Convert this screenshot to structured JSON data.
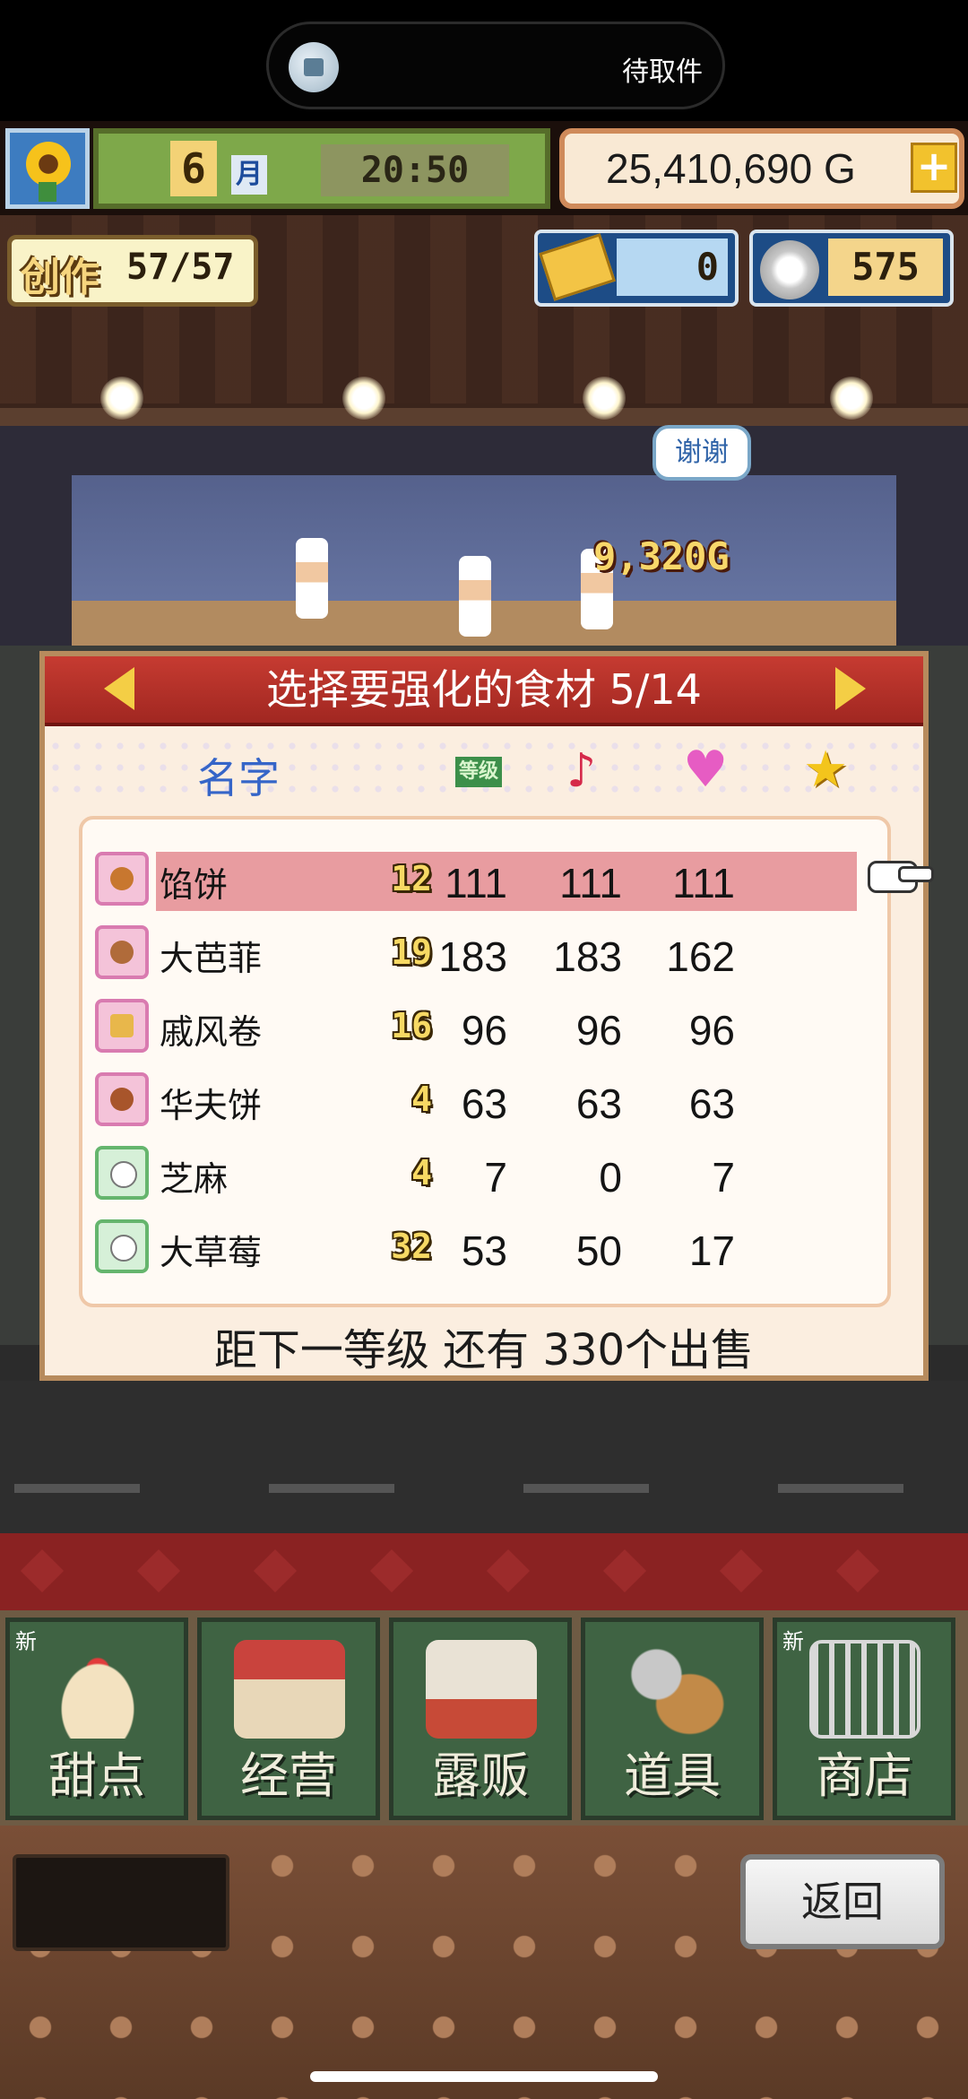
{
  "status_bar": {
    "notification_text": "待取件",
    "notification_icon": "package-icon"
  },
  "hud": {
    "season_icon": "sunflower-icon",
    "month": "6",
    "month_label": "月",
    "time": "20:50",
    "money": "25,410,690 G",
    "add_money_icon": "plus-icon",
    "create_label": "创作",
    "create_count": "57/57",
    "ticket_icon": "gold-ticket-icon",
    "tickets": "0",
    "medal_icon": "silver-medal-icon",
    "medals": "575"
  },
  "scene": {
    "speech_bubble": "谢谢",
    "earnings_popup": "9,320G"
  },
  "dialog": {
    "title": "选择要强化的食材 5/14",
    "prev_icon": "arrow-left-icon",
    "next_icon": "arrow-right-icon",
    "columns": {
      "name": "名字",
      "level": "等级",
      "note_icon": "music-note-icon",
      "heart_icon": "heart-icon",
      "star_icon": "star-icon"
    },
    "rows": [
      {
        "name": "馅饼",
        "level": "12",
        "v1": "111",
        "v2": "111",
        "v3": "111",
        "selected": true,
        "icon": "pie-icon"
      },
      {
        "name": "大芭菲",
        "level": "19",
        "v1": "183",
        "v2": "183",
        "v3": "162",
        "selected": false,
        "icon": "parfait-icon"
      },
      {
        "name": "戚风卷",
        "level": "16",
        "v1": "96",
        "v2": "96",
        "v3": "96",
        "selected": false,
        "icon": "chiffon-roll-icon"
      },
      {
        "name": "华夫饼",
        "level": "4",
        "v1": "63",
        "v2": "63",
        "v3": "63",
        "selected": false,
        "icon": "waffle-icon"
      },
      {
        "name": "芝麻",
        "level": "4",
        "v1": "7",
        "v2": "0",
        "v3": "7",
        "selected": false,
        "icon": "seed-bag-icon"
      },
      {
        "name": "大草莓",
        "level": "32",
        "v1": "53",
        "v2": "50",
        "v3": "17",
        "selected": false,
        "icon": "seed-bag-icon"
      }
    ],
    "footer": "距下一等级 还有  330个出售"
  },
  "menu": [
    {
      "label": "甜点",
      "new": "新",
      "icon": "cake-icon"
    },
    {
      "label": "经营",
      "new": "",
      "icon": "shop-icon"
    },
    {
      "label": "露贩",
      "new": "",
      "icon": "food-truck-icon"
    },
    {
      "label": "道具",
      "new": "",
      "icon": "gear-sack-icon"
    },
    {
      "label": "商店",
      "new": "新",
      "icon": "shopping-cart-icon"
    }
  ],
  "back_button": "返回"
}
